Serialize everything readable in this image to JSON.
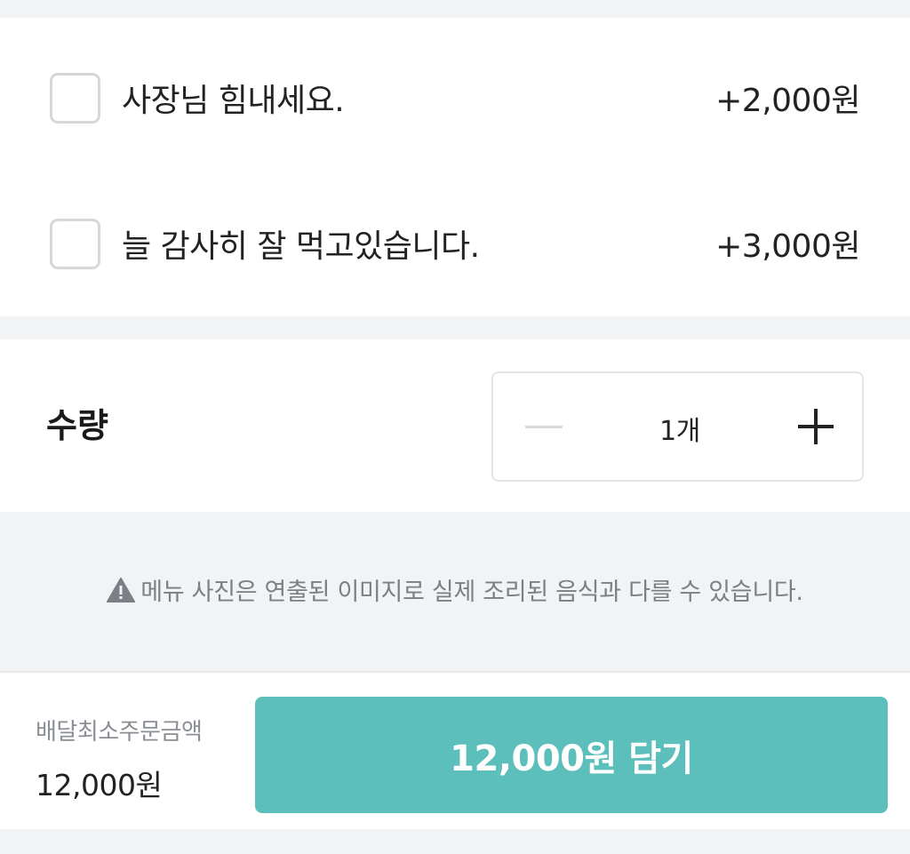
{
  "options": [
    {
      "label": "사장님 힘내세요.",
      "price": "+2,000원",
      "checked": false
    },
    {
      "label": "늘 감사히 잘 먹고있습니다.",
      "price": "+3,000원",
      "checked": false
    }
  ],
  "quantity": {
    "label": "수량",
    "value": "1개",
    "minus_icon": "minus-icon",
    "plus_icon": "plus-icon"
  },
  "notice": {
    "icon": "warning-icon",
    "text": "메뉴 사진은 연출된 이미지로 실제 조리된 음식과 다를 수 있습니다."
  },
  "footer": {
    "min_order_label": "배달최소주문금액",
    "min_order_value": "12,000원",
    "add_button_label": "12,000원 담기"
  },
  "colors": {
    "accent": "#5cbfbb",
    "background": "#f2f3f5",
    "checkbox_border": "#d5d7da",
    "muted_text": "#7b7f86"
  }
}
